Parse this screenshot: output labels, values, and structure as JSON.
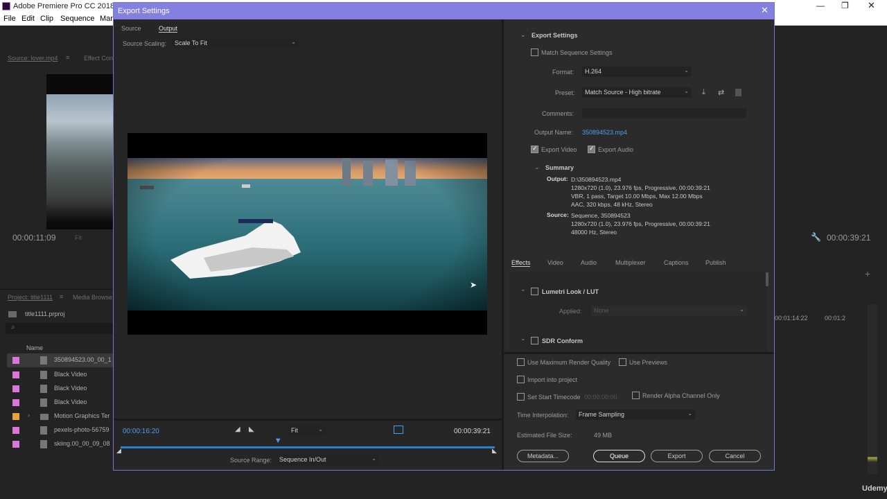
{
  "app": {
    "title": "Adobe Premiere Pro CC 2018",
    "menus": [
      "File",
      "Edit",
      "Clip",
      "Sequence",
      "Mar"
    ],
    "source_tab": "Source: lover.mp4",
    "effect_tab": "Effect Con",
    "source_timecode": "00:00:11:09",
    "source_zoom": "Fit",
    "program_timecode": "00:00:39:21",
    "project_tab": "Project: title1111",
    "media_tab": "Media Browse",
    "project_file": "title1111.prproj",
    "project_col_name": "Name",
    "project_items": [
      {
        "name": "350894523.00_00_1",
        "color": "#d977d6"
      },
      {
        "name": "Black Video",
        "color": "#d977d6"
      },
      {
        "name": "Black Video",
        "color": "#d977d6"
      },
      {
        "name": "Black Video",
        "color": "#d977d6"
      },
      {
        "name": "Motion Graphics Ter",
        "color": "#e8a23c"
      },
      {
        "name": "pexels-photo-56759",
        "color": "#d977d6"
      },
      {
        "name": "skiing.00_00_09_08",
        "color": "#d977d6"
      }
    ],
    "timeline_tc1": "00:01:14:22",
    "timeline_tc2": "00:01:2",
    "watermark": "Udemy"
  },
  "dialog": {
    "title": "Export Settings",
    "tabs": [
      "Source",
      "Output"
    ],
    "active_tab": "Output",
    "source_scaling_label": "Source Scaling:",
    "source_scaling_value": "Scale To Fit",
    "current_time": "00:00:16:20",
    "fit_value": "Fit",
    "duration": "00:00:39:21",
    "source_range_label": "Source Range:",
    "source_range_value": "Sequence In/Out",
    "playhead_fraction": 0.42,
    "export_settings": {
      "header": "Export Settings",
      "match_sequence": "Match Sequence Settings",
      "format_label": "Format:",
      "format_value": "H.264",
      "preset_label": "Preset:",
      "preset_value": "Match Source - High bitrate",
      "comments_label": "Comments:",
      "comments_value": "",
      "output_name_label": "Output Name:",
      "output_name_value": "350894523.mp4",
      "export_video": "Export Video",
      "export_audio": "Export Audio"
    },
    "summary": {
      "header": "Summary",
      "output_label": "Output:",
      "output_lines": [
        "D:\\350894523.mp4",
        "1280x720 (1.0), 23.976 fps, Progressive, 00:00:39:21",
        "VBR, 1 pass, Target 10.00 Mbps, Max 12.00 Mbps",
        "AAC, 320 kbps, 48 kHz, Stereo"
      ],
      "source_label": "Source:",
      "source_lines": [
        "Sequence, 350894523",
        "1280x720 (1.0), 23.976 fps, Progressive, 00:00:39:21",
        "48000 Hz, Stereo"
      ]
    },
    "settings_tabs": [
      "Effects",
      "Video",
      "Audio",
      "Multiplexer",
      "Captions",
      "Publish"
    ],
    "active_settings_tab": "Effects",
    "lumetri_label": "Lumetri Look / LUT",
    "applied_label": "Applied:",
    "applied_value": "None",
    "sdr_label": "SDR Conform",
    "options": {
      "max_render": "Use Maximum Render Quality",
      "use_previews": "Use Previews",
      "import_project": "Import into project",
      "set_timecode": "Set Start Timecode",
      "timecode_value": "00:00:00:00",
      "alpha_only": "Render Alpha Channel Only",
      "time_interp_label": "Time Interpolation:",
      "time_interp_value": "Frame Sampling",
      "file_size_label": "Estimated File Size:",
      "file_size_value": "49 MB"
    },
    "buttons": {
      "metadata": "Metadata...",
      "queue": "Queue",
      "export": "Export",
      "cancel": "Cancel"
    }
  }
}
